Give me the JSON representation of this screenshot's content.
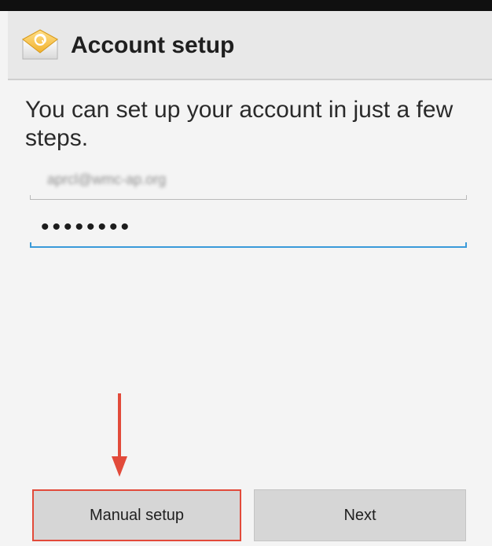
{
  "app": {
    "title": "Account setup",
    "icon": "email-app-icon"
  },
  "form": {
    "intro": "You can set up your account in just a few steps.",
    "email_value": "aprcl@wmc-ap.org",
    "password_value": "••••••••"
  },
  "buttons": {
    "manual_setup_label": "Manual setup",
    "next_label": "Next"
  },
  "colors": {
    "accent": "#3a9ad9",
    "highlight": "#e24a3a",
    "button_background": "#d6d6d6"
  }
}
